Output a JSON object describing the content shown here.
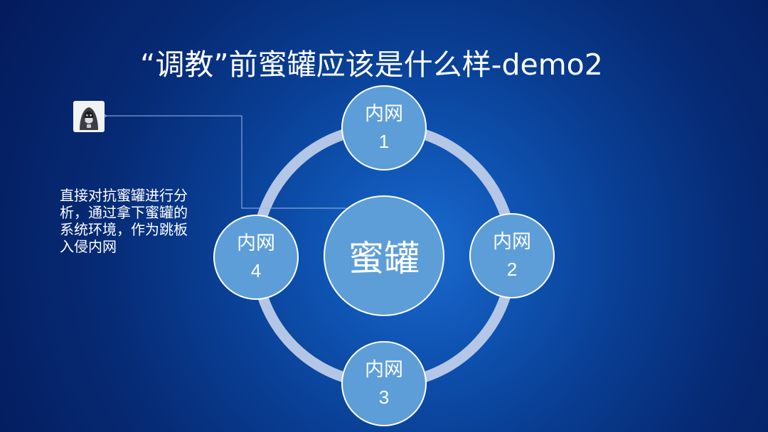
{
  "slide": {
    "title": "“调教”前蜜罐应该是什么样-demo2",
    "description": "直接对抗蜜罐进行分析，通过拿下蜜罐的系统环境，作为跳板入侵内网",
    "attacker_icon": "hacker-icon"
  },
  "diagram": {
    "center": {
      "label": "蜜罐"
    },
    "nodes": [
      {
        "label": "内网",
        "number": "1"
      },
      {
        "label": "内网",
        "number": "2"
      },
      {
        "label": "内网",
        "number": "3"
      },
      {
        "label": "内网",
        "number": "4"
      }
    ]
  },
  "colors": {
    "background_center": "#1a6ad0",
    "background_edge": "#041b5c",
    "node_fill": "#5d9ed9",
    "node_border": "#ffffff",
    "ring": "#c6d4ec",
    "connector": "#9fb8e2",
    "text": "#ffffff"
  }
}
